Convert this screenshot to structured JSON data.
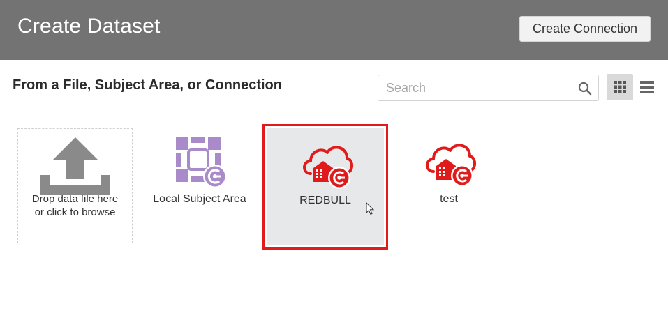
{
  "header": {
    "title": "Create Dataset",
    "create_connection_label": "Create Connection"
  },
  "toolbar": {
    "section_title": "From a File, Subject Area, or Connection",
    "search_placeholder": "Search",
    "grid_view_icon": "grid-icon",
    "list_view_icon": "list-icon"
  },
  "tiles": [
    {
      "label_line1": "Drop data file here",
      "label_line2": "or click to browse",
      "icon": "upload-icon"
    },
    {
      "label": "Local Subject Area",
      "icon": "subject-area-icon"
    },
    {
      "label": "REDBULL",
      "icon": "oracle-cloud-connection-icon",
      "selected": true
    },
    {
      "label": "test",
      "icon": "oracle-cloud-connection-icon"
    }
  ],
  "colors": {
    "header_bg": "#737373",
    "accent_red": "#e01b1b",
    "subject_area_purple": "#a98bc9"
  }
}
